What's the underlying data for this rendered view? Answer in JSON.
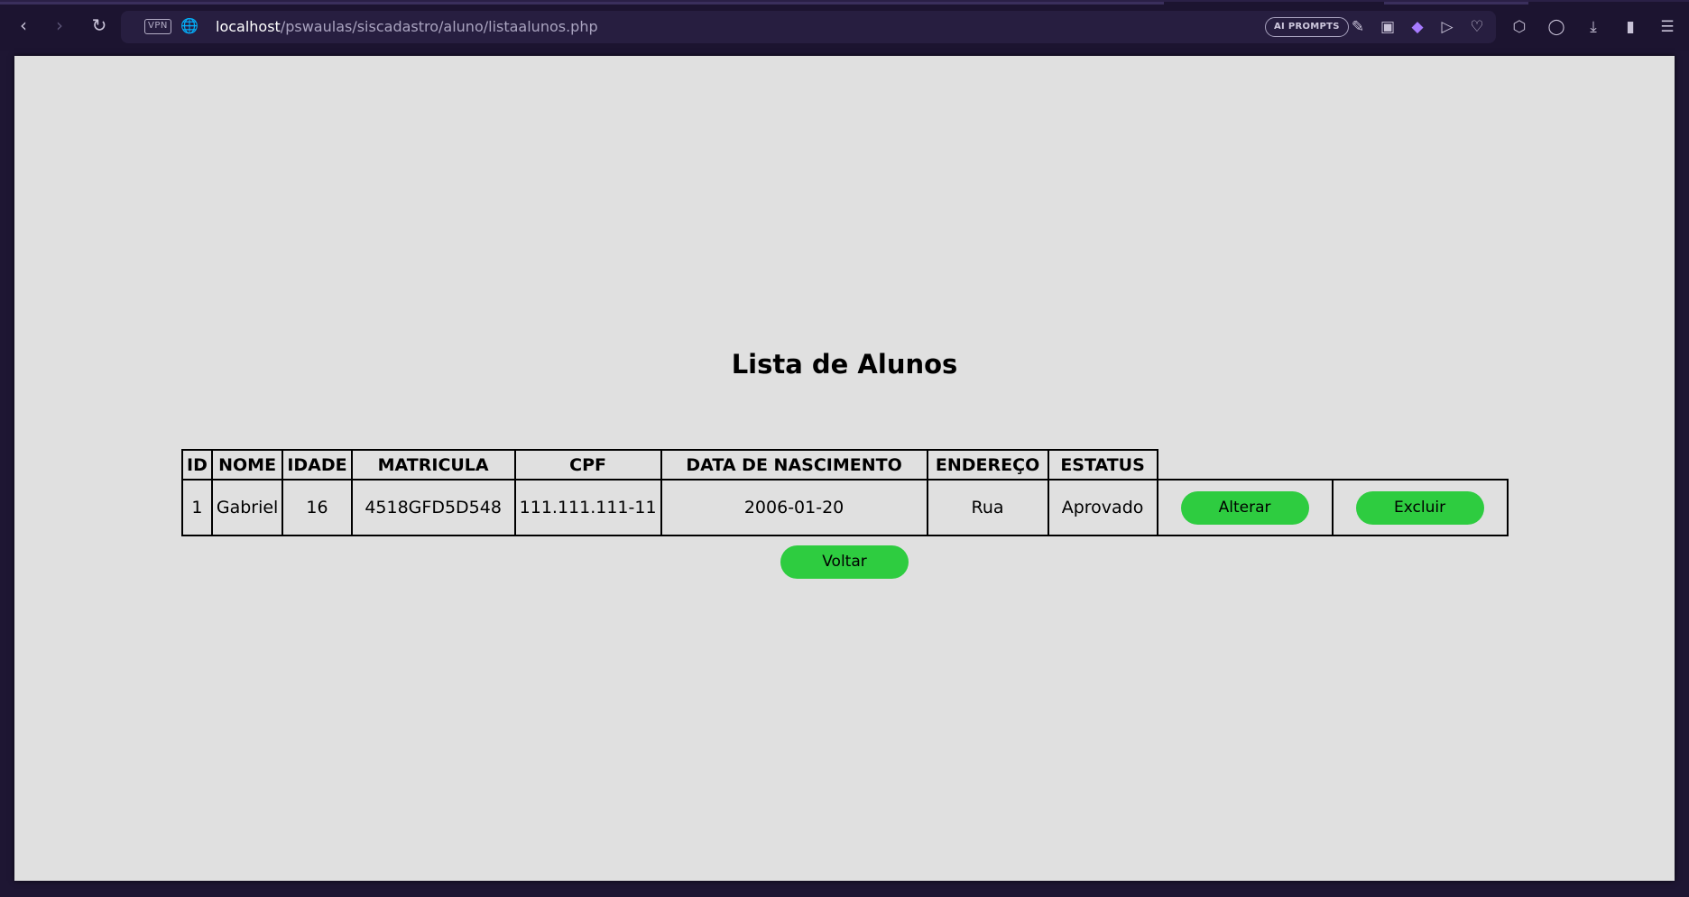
{
  "browser": {
    "vpn_label": "VPN",
    "url_host": "localhost",
    "url_path": "/pswaulas/siscadastro/aluno/listaalunos.php",
    "ai_prompts_label": "AI PROMPTS",
    "icons": {
      "back": "arrow-left-icon",
      "forward": "arrow-right-icon",
      "reload": "reload-icon",
      "globe": "globe-icon",
      "edit": "edit-icon",
      "camera": "camera-icon",
      "shield": "shield-icon",
      "send": "send-icon",
      "heart": "heart-icon",
      "box": "box-icon",
      "profile": "profile-icon",
      "download": "download-icon",
      "battery": "battery-icon",
      "menu": "menu-icon"
    }
  },
  "page": {
    "title": "Lista de Alunos",
    "table": {
      "headers": [
        "ID",
        "NOME",
        "IDADE",
        "MATRICULA",
        "CPF",
        "DATA DE NASCIMENTO",
        "ENDEREÇO",
        "ESTATUS"
      ],
      "rows": [
        {
          "id": "1",
          "nome": "Gabriel",
          "idade": "16",
          "matricula": "4518GFD5D548",
          "cpf": "111.111.111-11",
          "data_nascimento": "2006-01-20",
          "endereco": "Rua",
          "estatus": "Aprovado",
          "alterar_label": "Alterar",
          "excluir_label": "Excluir"
        }
      ]
    },
    "voltar_label": "Voltar",
    "colors": {
      "page_background": "#e0e0e0",
      "button_green": "#2ecc40",
      "browser_chrome": "#1c1430"
    }
  }
}
